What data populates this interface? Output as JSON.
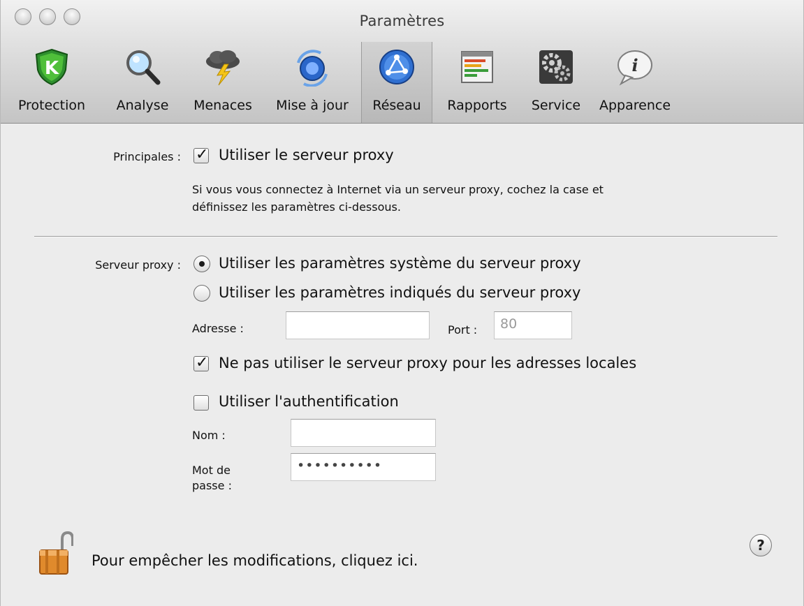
{
  "window": {
    "title": "Paramètres"
  },
  "toolbar": {
    "items": [
      {
        "label": "Protection",
        "icon": "shield-k-icon"
      },
      {
        "label": "Analyse",
        "icon": "magnifier-icon"
      },
      {
        "label": "Menaces",
        "icon": "storm-cloud-icon"
      },
      {
        "label": "Mise à jour",
        "icon": "update-globe-icon"
      },
      {
        "label": "Réseau",
        "icon": "network-icon",
        "selected": true
      },
      {
        "label": "Rapports",
        "icon": "reports-icon"
      },
      {
        "label": "Service",
        "icon": "gears-icon"
      },
      {
        "label": "Apparence",
        "icon": "info-bubble-icon"
      }
    ]
  },
  "principales": {
    "label": "Principales :",
    "use_proxy": {
      "label": "Utiliser le serveur proxy",
      "checked": true
    },
    "description_line1": "Si vous vous connectez à Internet via un serveur proxy, cochez la case et",
    "description_line2": "définissez les paramètres ci-dessous."
  },
  "proxy": {
    "label": "Serveur proxy :",
    "option_system": {
      "label": "Utiliser les paramètres système du serveur proxy",
      "selected": true
    },
    "option_custom": {
      "label": "Utiliser les paramètres indiqués du serveur proxy",
      "selected": false
    },
    "address_label": "Adresse :",
    "address_value": "",
    "port_label": "Port :",
    "port_value": "80",
    "bypass_local": {
      "label": "Ne pas utiliser le serveur proxy pour les adresses locales",
      "checked": true
    },
    "use_auth": {
      "label": "Utiliser l'authentification",
      "checked": false
    },
    "name_label": "Nom :",
    "name_value": "",
    "password_label_line1": "Mot de",
    "password_label_line2": "passe :",
    "password_value": "••••••••••"
  },
  "footer": {
    "lock_text": "Pour empêcher les modifications, cliquez ici.",
    "help_glyph": "?"
  },
  "colors": {
    "accent_selected_tab": "#bdbdbd",
    "window_bg": "#ececec"
  }
}
